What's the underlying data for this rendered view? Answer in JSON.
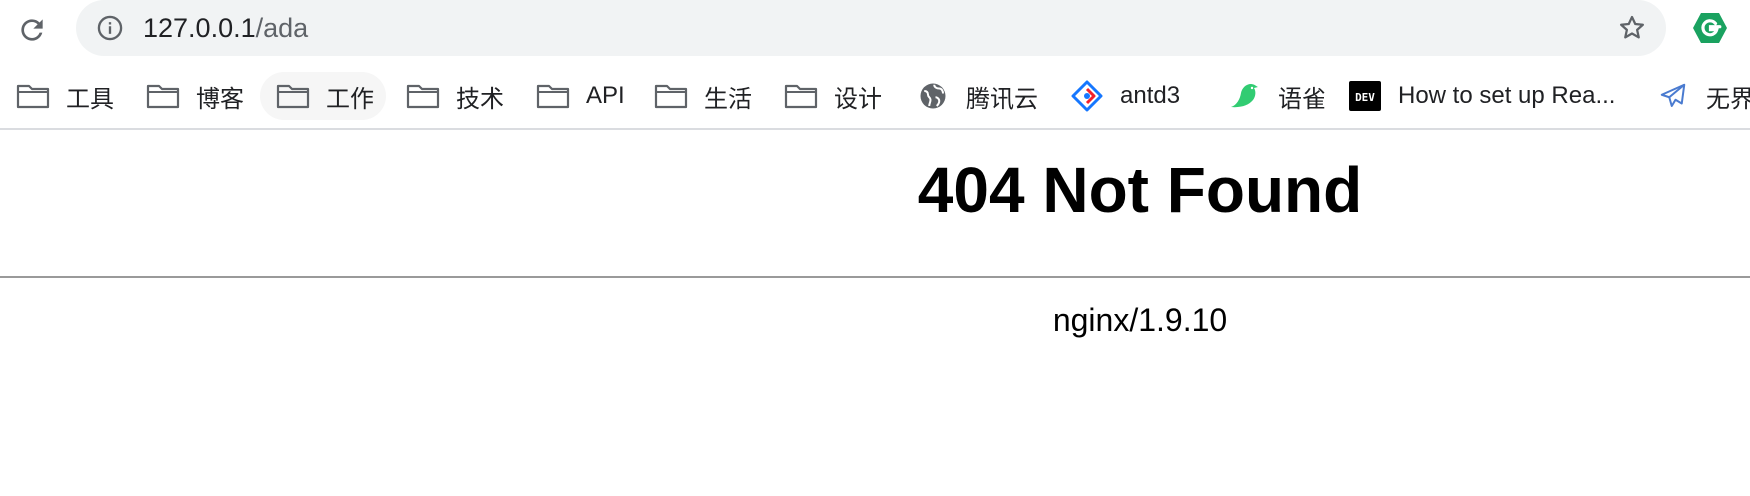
{
  "browser": {
    "url_host": "127.0.0.1",
    "url_path": "/ada"
  },
  "bookmarks": [
    {
      "label": "工具",
      "icon": "folder-icon"
    },
    {
      "label": "博客",
      "icon": "folder-icon"
    },
    {
      "label": "工作",
      "icon": "folder-icon"
    },
    {
      "label": "技术",
      "icon": "folder-icon"
    },
    {
      "label": "API",
      "icon": "folder-icon"
    },
    {
      "label": "生活",
      "icon": "folder-icon"
    },
    {
      "label": "设计",
      "icon": "folder-icon"
    },
    {
      "label": "腾讯云",
      "icon": "globe-icon"
    },
    {
      "label": "antd3",
      "icon": "antd-logo-icon"
    },
    {
      "label": "语雀",
      "icon": "yuque-bird-icon"
    },
    {
      "label": "How to set up Rea...",
      "icon": "dev-logo-icon"
    },
    {
      "label": "无界",
      "icon": "paper-plane-icon"
    }
  ],
  "page": {
    "heading": "404 Not Found",
    "server": "nginx/1.9.10"
  },
  "colors": {
    "omnibox_bg": "#f1f3f4",
    "extension_green": "#1aa260",
    "antd_blue": "#1677ff",
    "antd_red": "#f5222d",
    "yuque_green": "#31cc72",
    "dev_black": "#000000",
    "folder_gray": "#5f6368"
  }
}
